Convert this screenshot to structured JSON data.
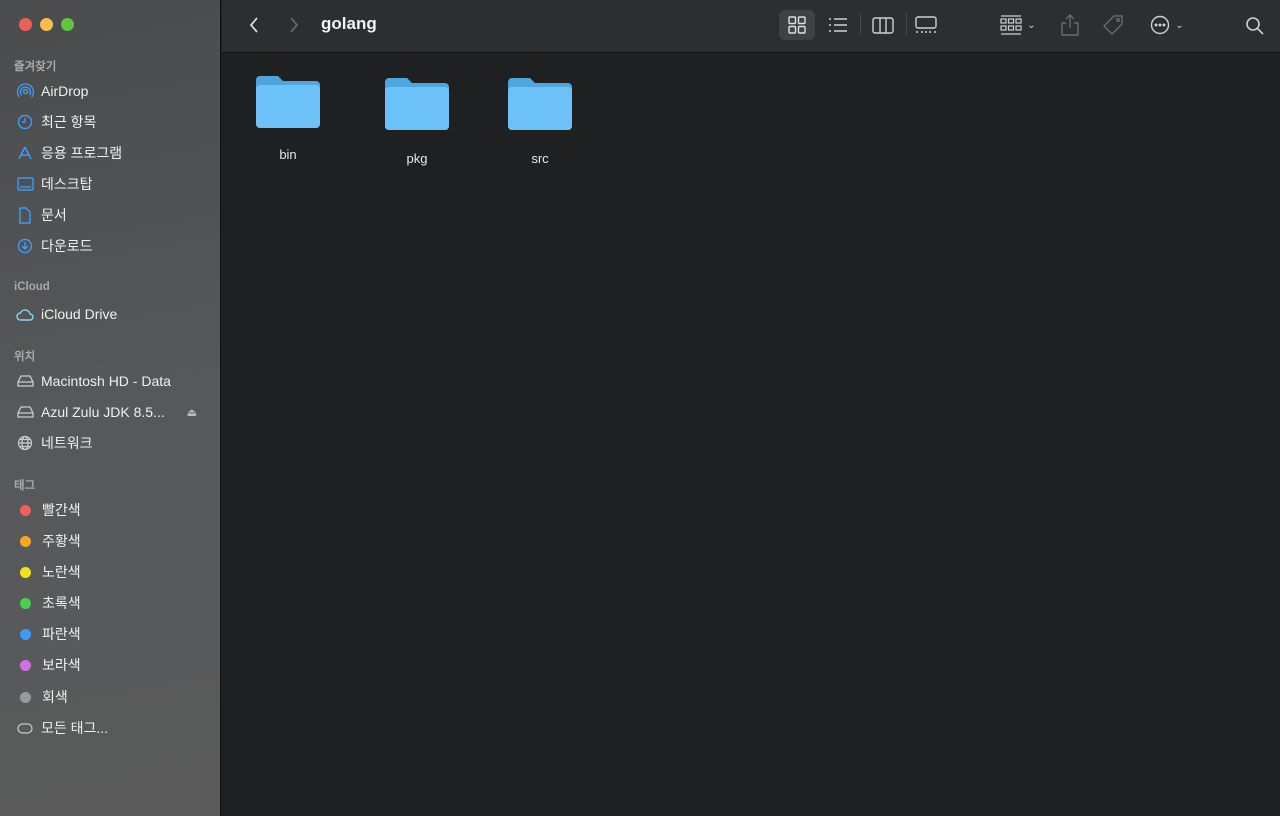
{
  "window": {
    "title": "golang"
  },
  "sidebar": {
    "sections": [
      {
        "label": "즐겨찾기",
        "items": [
          {
            "label": "AirDrop",
            "icon": "airdrop-icon"
          },
          {
            "label": "최근 항목",
            "icon": "clock-icon"
          },
          {
            "label": "응용 프로그램",
            "icon": "applications-icon"
          },
          {
            "label": "데스크탑",
            "icon": "desktop-icon"
          },
          {
            "label": "문서",
            "icon": "document-icon"
          },
          {
            "label": "다운로드",
            "icon": "download-icon"
          }
        ]
      },
      {
        "label": "iCloud",
        "items": [
          {
            "label": "iCloud Drive",
            "icon": "cloud-icon"
          }
        ]
      },
      {
        "label": "위치",
        "items": [
          {
            "label": "Macintosh HD - Data",
            "icon": "disk-icon"
          },
          {
            "label": "Azul Zulu JDK 8.5...",
            "icon": "disk-icon"
          },
          {
            "label": "네트워크",
            "icon": "globe-icon"
          }
        ]
      },
      {
        "label": "태그",
        "items": [
          {
            "label": "빨간색",
            "color": "#f0605a"
          },
          {
            "label": "주황색",
            "color": "#f5a623"
          },
          {
            "label": "노란색",
            "color": "#f2e21c"
          },
          {
            "label": "초록색",
            "color": "#47d14a"
          },
          {
            "label": "파란색",
            "color": "#3b9bf5"
          },
          {
            "label": "보라색",
            "color": "#d36ee6"
          },
          {
            "label": "회색",
            "color": "#9a9a9a"
          },
          {
            "label": "모든 태그...",
            "icon": "all-tags-icon"
          }
        ]
      }
    ]
  },
  "files": [
    {
      "name": "bin"
    },
    {
      "name": "pkg"
    },
    {
      "name": "src"
    }
  ],
  "colors": {
    "accent": "#3b9bf5",
    "folder": "#6cc2f8"
  }
}
